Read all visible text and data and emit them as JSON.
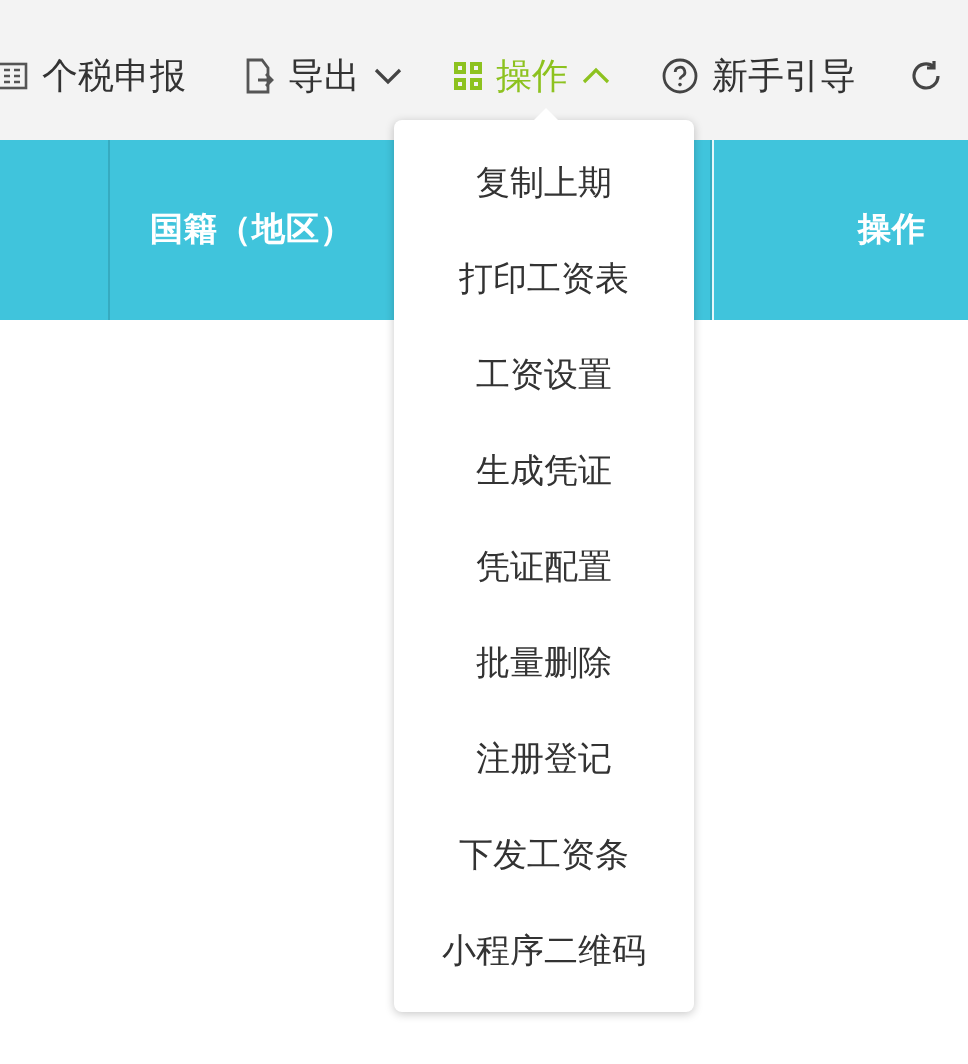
{
  "toolbar": [
    {
      "label": "个税申报",
      "kind": "report"
    },
    {
      "label": "导出",
      "kind": "export",
      "expanded": false
    },
    {
      "label": "操作",
      "kind": "actions",
      "expanded": true
    },
    {
      "label": "新手引导",
      "kind": "help"
    },
    {
      "kind": "refresh"
    }
  ],
  "table": {
    "columns": [
      "国籍（地区）",
      "操作"
    ]
  },
  "menu": {
    "items": [
      "复制上期",
      "打印工资表",
      "工资设置",
      "生成凭证",
      "凭证配置",
      "批量删除",
      "注册登记",
      "下发工资条",
      "小程序二维码"
    ]
  }
}
